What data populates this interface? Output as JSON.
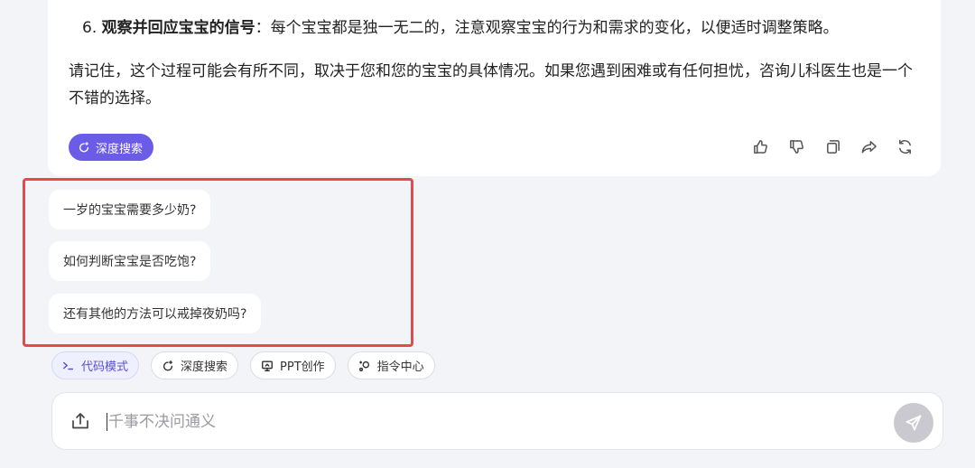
{
  "answer": {
    "point_number": "6.",
    "point_title": "观察并回应宝宝的信号",
    "point_body": "：每个宝宝都是独一无二的，注意观察宝宝的行为和需求的变化，以便适时调整策略。",
    "summary": "请记住，这个过程可能会有所不同，取决于您和您的宝宝的具体情况。如果您遇到困难或有任何担忧，咨询儿科医生也是一个不错的选择。",
    "deep_search_badge": "深度搜索"
  },
  "suggestions": [
    "一岁的宝宝需要多少奶?",
    "如何判断宝宝是否吃饱?",
    "还有其他的方法可以戒掉夜奶吗?"
  ],
  "tools": {
    "code_mode": "代码模式",
    "deep_search": "深度搜索",
    "ppt": "PPT创作",
    "commands": "指令中心"
  },
  "input": {
    "placeholder": "千事不决问通义",
    "value": ""
  },
  "colors": {
    "accent": "#6b5ce7",
    "highlight_border": "#e34a4a",
    "background": "#f3f4f7"
  }
}
